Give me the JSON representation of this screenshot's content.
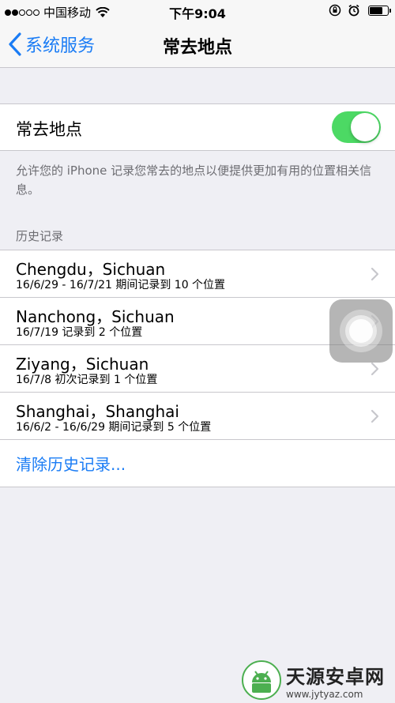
{
  "status_bar": {
    "carrier": "中国移动",
    "time": "下午9:04",
    "signal_bars_filled": 2,
    "signal_bars_total": 5
  },
  "nav": {
    "back_label": "系统服务",
    "title": "常去地点"
  },
  "toggle_section": {
    "label": "常去地点",
    "enabled": true,
    "footer": "允许您的 iPhone 记录您常去的地点以便提供更加有用的位置相关信息。"
  },
  "history": {
    "header": "历史记录",
    "items": [
      {
        "title": "Chengdu，Sichuan",
        "subtitle": "16/6/29 - 16/7/21 期间记录到 10 个位置"
      },
      {
        "title": "Nanchong，Sichuan",
        "subtitle": "16/7/19 记录到 2 个位置"
      },
      {
        "title": "Ziyang，Sichuan",
        "subtitle": "16/7/8 初次记录到 1 个位置"
      },
      {
        "title": "Shanghai，Shanghai",
        "subtitle": "16/6/2 - 16/6/29 期间记录到 5 个位置"
      }
    ],
    "clear_label": "清除历史记录..."
  },
  "watermark": {
    "title": "天源安卓网",
    "url": "www.jytyaz.com"
  },
  "colors": {
    "accent": "#1a7cf5",
    "toggle_on": "#4cd964",
    "background": "#efeff4"
  }
}
